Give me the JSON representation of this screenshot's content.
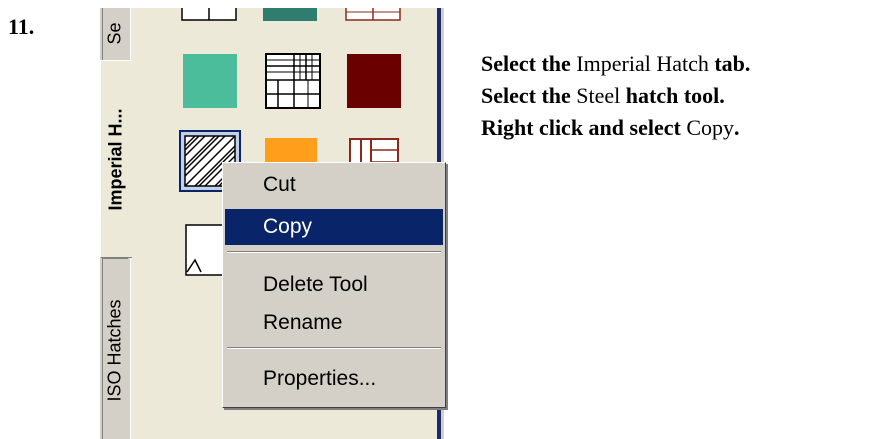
{
  "step_number": "11.",
  "palette": {
    "tabs": [
      {
        "label": "Se",
        "state": "partial"
      },
      {
        "label": "Imperial H...",
        "state": "active"
      },
      {
        "label": "ISO Hatches",
        "state": "inactive"
      }
    ],
    "colors": {
      "teal_dark": "#2e7d6e",
      "green": "#4bbd9b",
      "maroon": "#6b0000",
      "orange": "#ff9e1a",
      "brown": "#8b2a1a",
      "selection_blue": "#0a246a"
    }
  },
  "context_menu": {
    "items": [
      {
        "label": "Cut",
        "highlighted": false
      },
      {
        "label": "Copy",
        "highlighted": true
      },
      {
        "label": "Delete Tool",
        "highlighted": false
      },
      {
        "label": "Rename",
        "highlighted": false
      },
      {
        "label": "Properties...",
        "highlighted": false
      }
    ]
  },
  "instructions": {
    "line1": {
      "pre": "Select the",
      "value": "Imperial Hatch",
      "post": "tab."
    },
    "line2": {
      "pre": "Select the",
      "value": "Steel",
      "post": "hatch tool."
    },
    "line3": {
      "pre": "Right click and select",
      "value": "Copy",
      "post": "."
    }
  }
}
